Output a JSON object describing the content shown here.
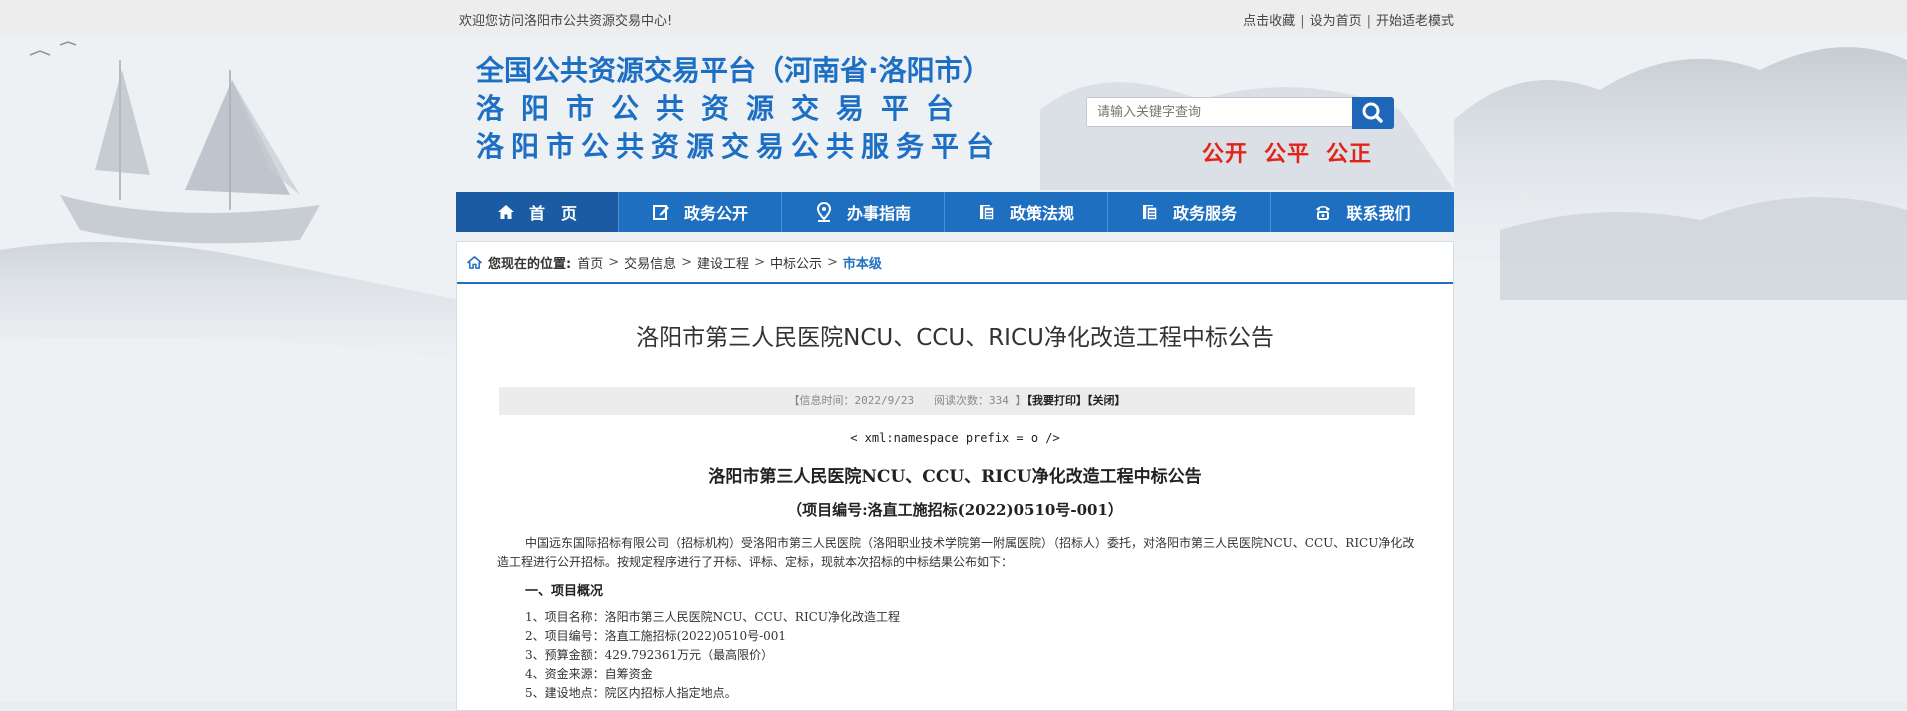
{
  "topbar": {
    "welcome": "欢迎您访问洛阳市公共资源交易中心!",
    "links": [
      "点击收藏",
      "设为首页",
      "开始适老模式"
    ],
    "separator": "|"
  },
  "header": {
    "title1": "全国公共资源交易平台（河南省·洛阳市）",
    "title2": "洛阳市公共资源交易平台",
    "title3": "洛阳市公共资源交易公共服务平台",
    "search_placeholder": "请输入关键字查询",
    "slogan": [
      "公开",
      "公平",
      "公正"
    ]
  },
  "nav": [
    {
      "label": "首　页",
      "icon": "home-icon"
    },
    {
      "label": "政务公开",
      "icon": "edit-icon"
    },
    {
      "label": "办事指南",
      "icon": "location-icon"
    },
    {
      "label": "政策法规",
      "icon": "document-icon"
    },
    {
      "label": "政务服务",
      "icon": "document-icon"
    },
    {
      "label": "联系我们",
      "icon": "phone-icon"
    }
  ],
  "breadcrumb": {
    "label": "您现在的位置:",
    "items": [
      "首页",
      "交易信息",
      "建设工程",
      "中标公示"
    ],
    "current": "市本级",
    "separator": ">"
  },
  "article": {
    "title": "洛阳市第三人民医院NCU、CCU、RICU净化改造工程中标公告",
    "meta_prefix": "【信息时间：",
    "meta_date": "2022/9/23",
    "meta_views_label": "阅读次数：",
    "meta_views": "334",
    "meta_suffix": "】",
    "print_label": "【我要打印】",
    "close_label": "【关闭】",
    "xml_line": "< xml:namespace prefix = o />",
    "heading": "洛阳市第三人民医院NCU、CCU、RICU净化改造工程中标公告",
    "subheading": "（项目编号:洛直工施招标(2022)0510号-001）",
    "intro": "中国远东国际招标有限公司（招标机构）受洛阳市第三人民医院（洛阳职业技术学院第一附属医院）（招标人）委托，对洛阳市第三人民医院NCU、CCU、RICU净化改造工程进行公开招标。按规定程序进行了开标、评标、定标，现就本次招标的中标结果公布如下：",
    "section1": "一、项目概况",
    "items": [
      "1、项目名称：洛阳市第三人民医院NCU、CCU、RICU净化改造工程",
      "2、项目编号：洛直工施招标(2022)0510号-001",
      "3、预算金额：429.792361万元（最高限价）",
      "4、资金来源：自筹资金",
      "5、建设地点：院区内招标人指定地点。"
    ]
  },
  "colors": {
    "nav_blue": "#1f6fc1",
    "title_blue": "#1d6fc4",
    "slogan_red": "#e2231a"
  }
}
